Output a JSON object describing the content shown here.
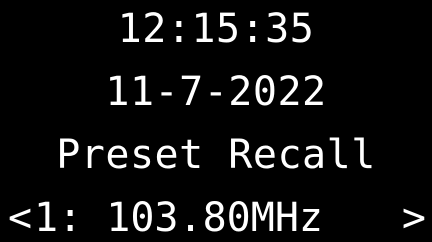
{
  "display": {
    "time": "12:15:35",
    "date": "11-7-2022",
    "mode": "Preset Recall",
    "preset": {
      "prev_arrow": "<",
      "text": "1: 103.80MHz",
      "next_arrow": ">"
    }
  },
  "colors": {
    "background": "#000000",
    "text": "#ffffff"
  }
}
